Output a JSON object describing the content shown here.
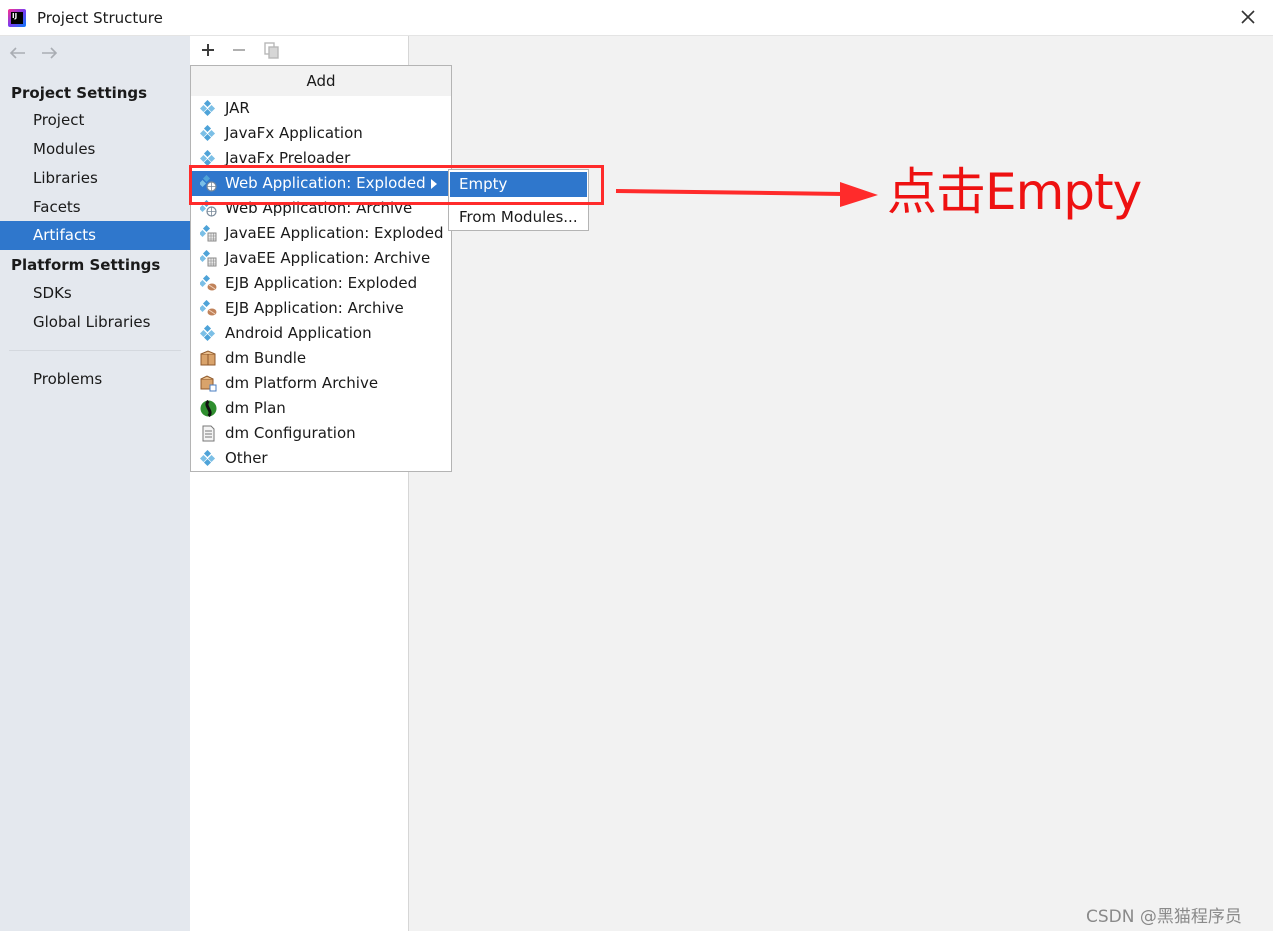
{
  "window": {
    "title": "Project Structure",
    "app_icon_text": "IJ"
  },
  "sidebar": {
    "project_settings_header": "Project Settings",
    "project_items": [
      "Project",
      "Modules",
      "Libraries",
      "Facets",
      "Artifacts"
    ],
    "selected_item": "Artifacts",
    "platform_settings_header": "Platform Settings",
    "platform_items": [
      "SDKs",
      "Global Libraries"
    ],
    "problems": "Problems"
  },
  "toolbar": {
    "add": "+",
    "remove": "−",
    "copy": "copy"
  },
  "popup": {
    "header": "Add",
    "items": [
      {
        "label": "JAR",
        "icon": "artifact-diamond-icon"
      },
      {
        "label": "JavaFx Application",
        "icon": "artifact-diamond-icon"
      },
      {
        "label": "JavaFx Preloader",
        "icon": "artifact-diamond-icon"
      },
      {
        "label": "Web Application: Exploded",
        "icon": "web-artifact-icon",
        "highlighted": true,
        "has_submenu": true
      },
      {
        "label": "Web Application: Archive",
        "icon": "web-artifact-icon"
      },
      {
        "label": "JavaEE Application: Exploded",
        "icon": "javaee-artifact-icon"
      },
      {
        "label": "JavaEE Application: Archive",
        "icon": "javaee-artifact-icon"
      },
      {
        "label": "EJB Application: Exploded",
        "icon": "ejb-artifact-icon"
      },
      {
        "label": "EJB Application: Archive",
        "icon": "ejb-artifact-icon"
      },
      {
        "label": "Android Application",
        "icon": "artifact-diamond-icon"
      },
      {
        "label": "dm Bundle",
        "icon": "dm-bundle-icon"
      },
      {
        "label": "dm Platform Archive",
        "icon": "dm-platform-icon"
      },
      {
        "label": "dm Plan",
        "icon": "dm-plan-icon"
      },
      {
        "label": "dm Configuration",
        "icon": "dm-config-icon"
      },
      {
        "label": "Other",
        "icon": "artifact-diamond-icon"
      }
    ]
  },
  "submenu": {
    "items": [
      {
        "label": "Empty",
        "highlighted": true
      },
      {
        "label": "From Modules..."
      }
    ]
  },
  "annotation": {
    "text": "点击Empty",
    "color": "#ee1111"
  },
  "watermark": "CSDN @黑猫程序员",
  "colors": {
    "selection": "#2f77cc",
    "sidebar_bg": "#e4e8ee",
    "content_bg": "#f2f2f2"
  }
}
